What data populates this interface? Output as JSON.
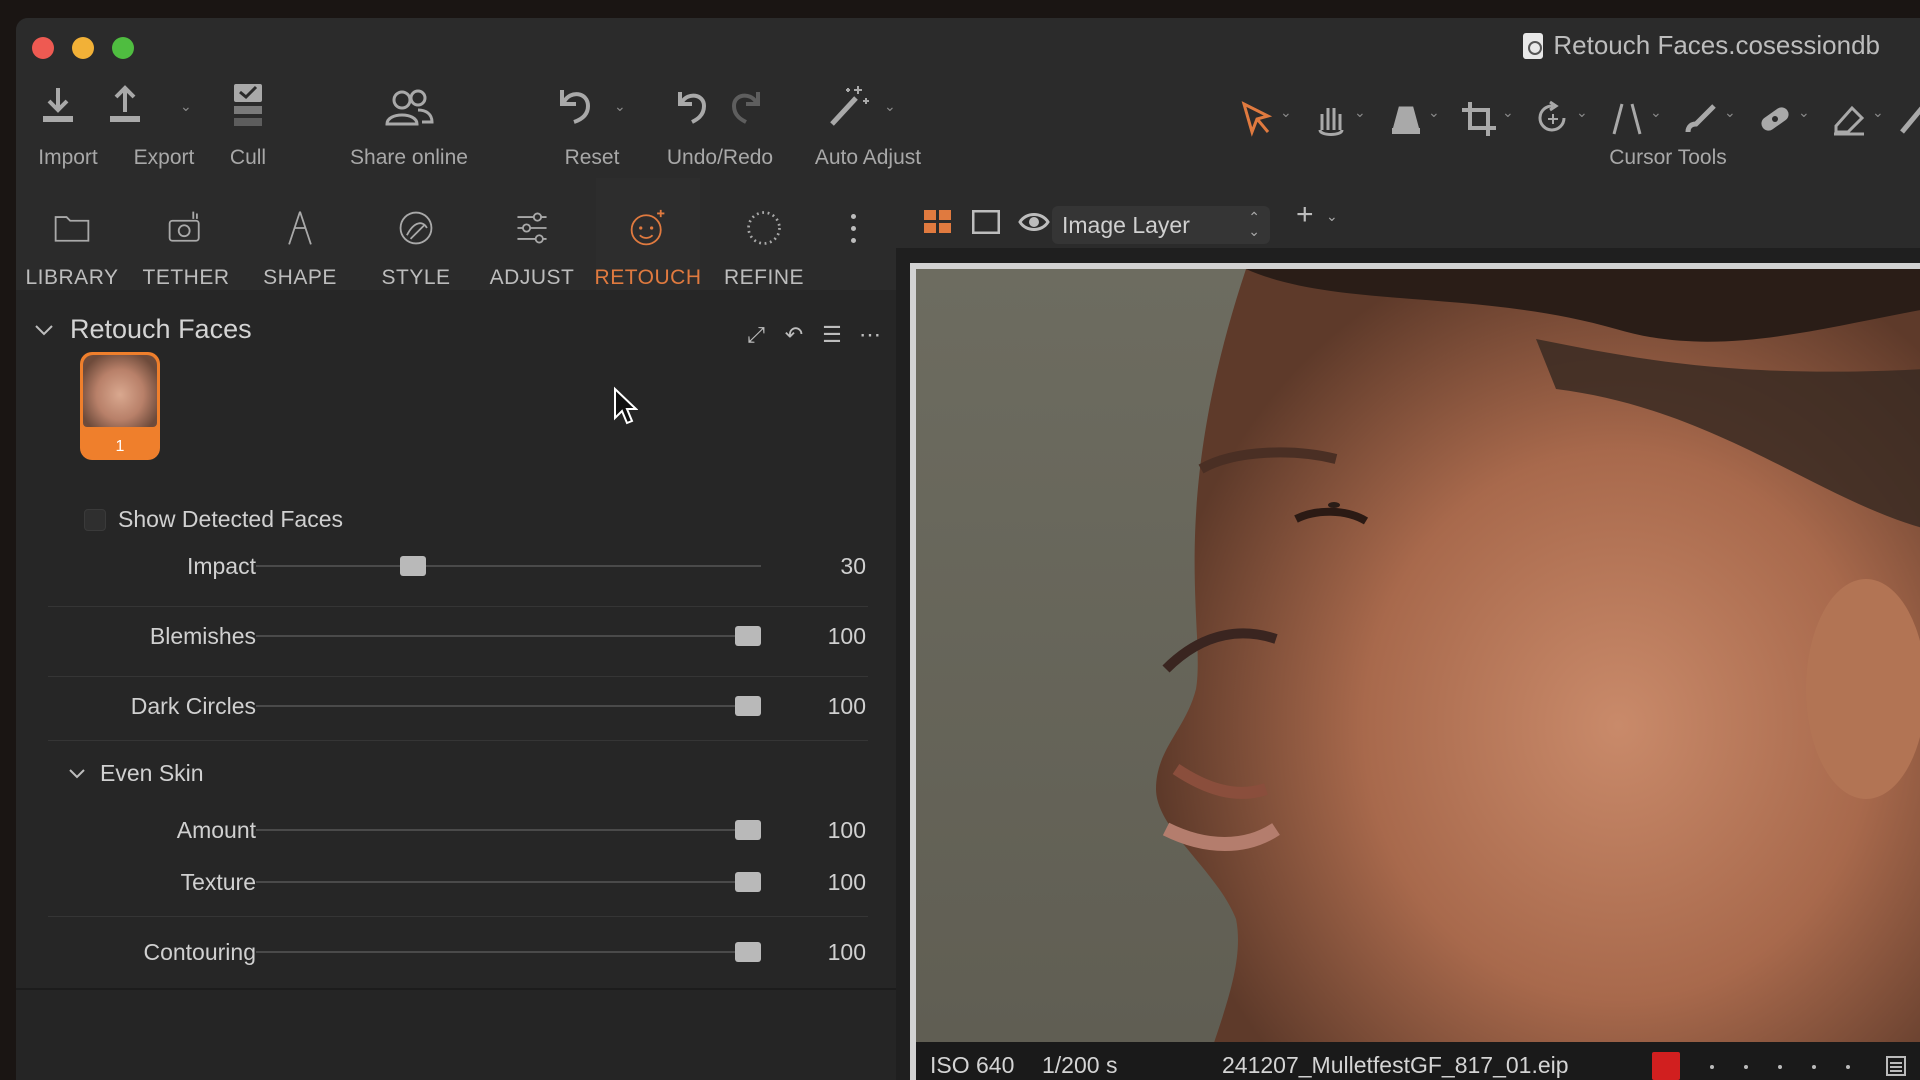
{
  "window": {
    "title": "Retouch Faces.cosessiondb"
  },
  "toolbar": {
    "import": "Import",
    "export": "Export",
    "cull": "Cull",
    "share": "Share online",
    "reset": "Reset",
    "undo_redo": "Undo/Redo",
    "auto_adjust": "Auto Adjust",
    "cursor_tools": "Cursor Tools"
  },
  "tabs": [
    {
      "label": "LIBRARY"
    },
    {
      "label": "TETHER"
    },
    {
      "label": "SHAPE"
    },
    {
      "label": "STYLE"
    },
    {
      "label": "ADJUST"
    },
    {
      "label": "RETOUCH",
      "active": true
    },
    {
      "label": "REFINE"
    }
  ],
  "panel": {
    "title": "Retouch Faces",
    "face_number": "1",
    "show_detected_faces": "Show Detected Faces",
    "sliders": [
      {
        "label": "Impact",
        "value": "30",
        "fraction": 0.3
      },
      {
        "label": "Blemishes",
        "value": "100",
        "fraction": 1.0
      },
      {
        "label": "Dark Circles",
        "value": "100",
        "fraction": 1.0
      }
    ],
    "even_skin": {
      "title": "Even Skin",
      "sliders": [
        {
          "label": "Amount",
          "value": "100",
          "fraction": 1.0
        },
        {
          "label": "Texture",
          "value": "100",
          "fraction": 1.0
        }
      ]
    },
    "contouring": {
      "label": "Contouring",
      "value": "100",
      "fraction": 1.0
    }
  },
  "viewer": {
    "layer": "Image Layer",
    "iso": "ISO 640",
    "shutter": "1/200 s",
    "filename": "241207_MulletfestGF_817_01.eip"
  },
  "colors": {
    "accent": "#e07a3f",
    "label_red": "#d11f1f"
  }
}
